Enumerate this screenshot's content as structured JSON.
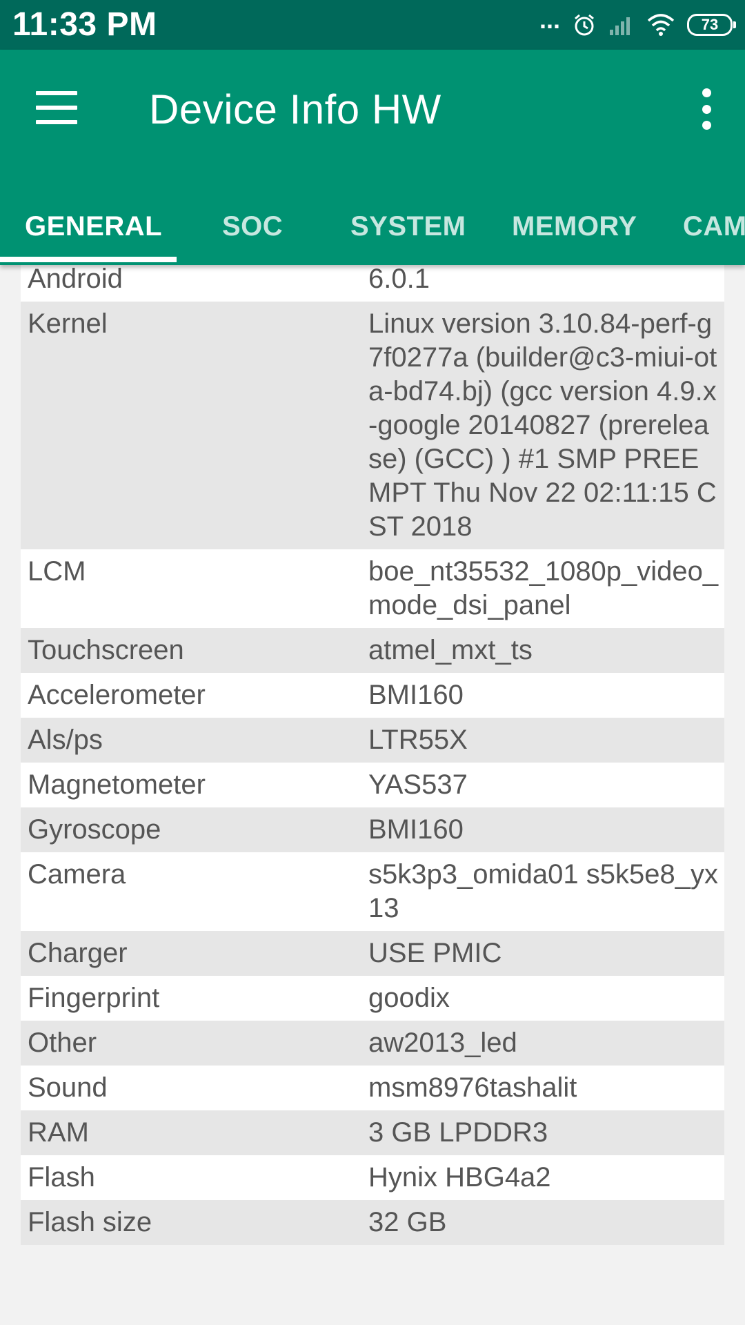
{
  "status_bar": {
    "time": "11:33 PM",
    "dots": "...",
    "battery": "73"
  },
  "app_bar": {
    "title": "Device Info HW"
  },
  "tabs": [
    {
      "label": "GENERAL"
    },
    {
      "label": "SOC"
    },
    {
      "label": "SYSTEM"
    },
    {
      "label": "MEMORY"
    },
    {
      "label": "CAM"
    }
  ],
  "rows": [
    {
      "key": "Android",
      "value": "6.0.1"
    },
    {
      "key": "Kernel",
      "value": "Linux version 3.10.84-perf-g7f0277a (builder@c3-miui-ota-bd74.bj) (gcc version 4.9.x-google 20140827 (prerelease) (GCC) ) #1 SMP PREEMPT Thu Nov 22 02:11:15 CST 2018"
    },
    {
      "key": "LCM",
      "value": "boe_nt35532_1080p_video_mode_dsi_panel"
    },
    {
      "key": "Touchscreen",
      "value": "atmel_mxt_ts"
    },
    {
      "key": "Accelerometer",
      "value": "BMI160"
    },
    {
      "key": "Als/ps",
      "value": "LTR55X"
    },
    {
      "key": "Magnetometer",
      "value": "YAS537"
    },
    {
      "key": "Gyroscope",
      "value": "BMI160"
    },
    {
      "key": "Camera",
      "value": "s5k3p3_omida01 s5k5e8_yx13"
    },
    {
      "key": "Charger",
      "value": "USE PMIC"
    },
    {
      "key": "Fingerprint",
      "value": "goodix"
    },
    {
      "key": "Other",
      "value": "aw2013_led"
    },
    {
      "key": "Sound",
      "value": "msm8976tashalit"
    },
    {
      "key": "RAM",
      "value": "3 GB LPDDR3"
    },
    {
      "key": "Flash",
      "value": "Hynix HBG4a2"
    },
    {
      "key": "Flash size",
      "value": "32 GB"
    }
  ]
}
